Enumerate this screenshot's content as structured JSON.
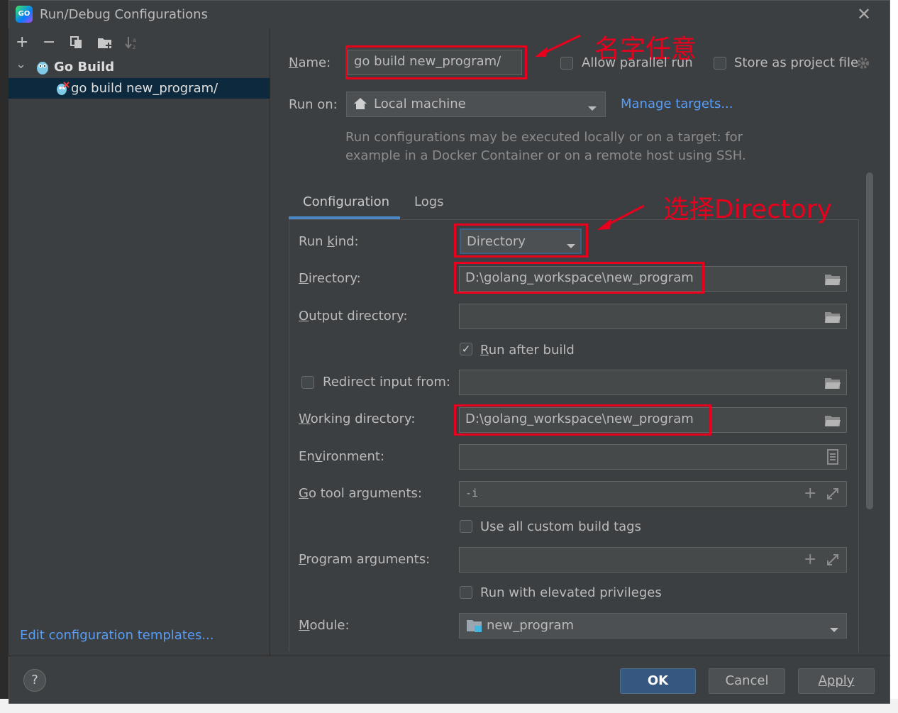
{
  "window": {
    "title": "Run/Debug Configurations",
    "app_icon": "goland-icon",
    "close_glyph": "✕"
  },
  "toolbar": {
    "add_glyph": "+",
    "remove_glyph": "−"
  },
  "tree": {
    "group_label": "Go Build",
    "item_label": "go build new_program/",
    "expand_glyph": "⌄"
  },
  "left_footer": {
    "edit_templates_link": "Edit configuration templates..."
  },
  "header": {
    "name_label": "Name:",
    "name_value": "go build new_program/",
    "allow_parallel_label": "Allow parallel run",
    "allow_parallel_checked": false,
    "store_project_label": "Store as project file",
    "store_project_checked": false,
    "run_on_label": "Run on:",
    "run_on_value": "Local machine",
    "manage_targets_link": "Manage targets...",
    "hint_line1": "Run configurations may be executed locally or on a target: for",
    "hint_line2": "example in a Docker Container or on a remote host using SSH."
  },
  "tabs": [
    {
      "label": "Configuration",
      "active": true
    },
    {
      "label": "Logs",
      "active": false
    }
  ],
  "form": {
    "run_kind_label": "Run kind:",
    "run_kind_value": "Directory",
    "directory_label": "Directory:",
    "directory_value": "D:\\golang_workspace\\new_program",
    "output_dir_label": "Output directory:",
    "output_dir_value": "",
    "run_after_build_label": "Run after build",
    "run_after_build_checked": true,
    "redirect_label": "Redirect input from:",
    "redirect_checked": false,
    "redirect_value": "",
    "working_dir_label": "Working directory:",
    "working_dir_value": "D:\\golang_workspace\\new_program",
    "environment_label": "Environment:",
    "environment_value": "",
    "go_tool_args_label": "Go tool arguments:",
    "go_tool_args_value": "-i",
    "custom_tags_label": "Use all custom build tags",
    "custom_tags_checked": false,
    "program_args_label": "Program arguments:",
    "program_args_value": "",
    "elevated_label": "Run with elevated privileges",
    "elevated_checked": false,
    "module_label": "Module:",
    "module_value": "new_program"
  },
  "annotations": {
    "name_note": "名字任意",
    "directory_note": "选择Directory"
  },
  "buttons": {
    "help": "?",
    "ok": "OK",
    "cancel": "Cancel",
    "apply": "Apply"
  },
  "colors": {
    "dialog_bg": "#3c3f41",
    "selection_bg": "#0d293e",
    "link": "#589df6",
    "annotation_red": "#e8001c",
    "ok_button": "#365880"
  }
}
